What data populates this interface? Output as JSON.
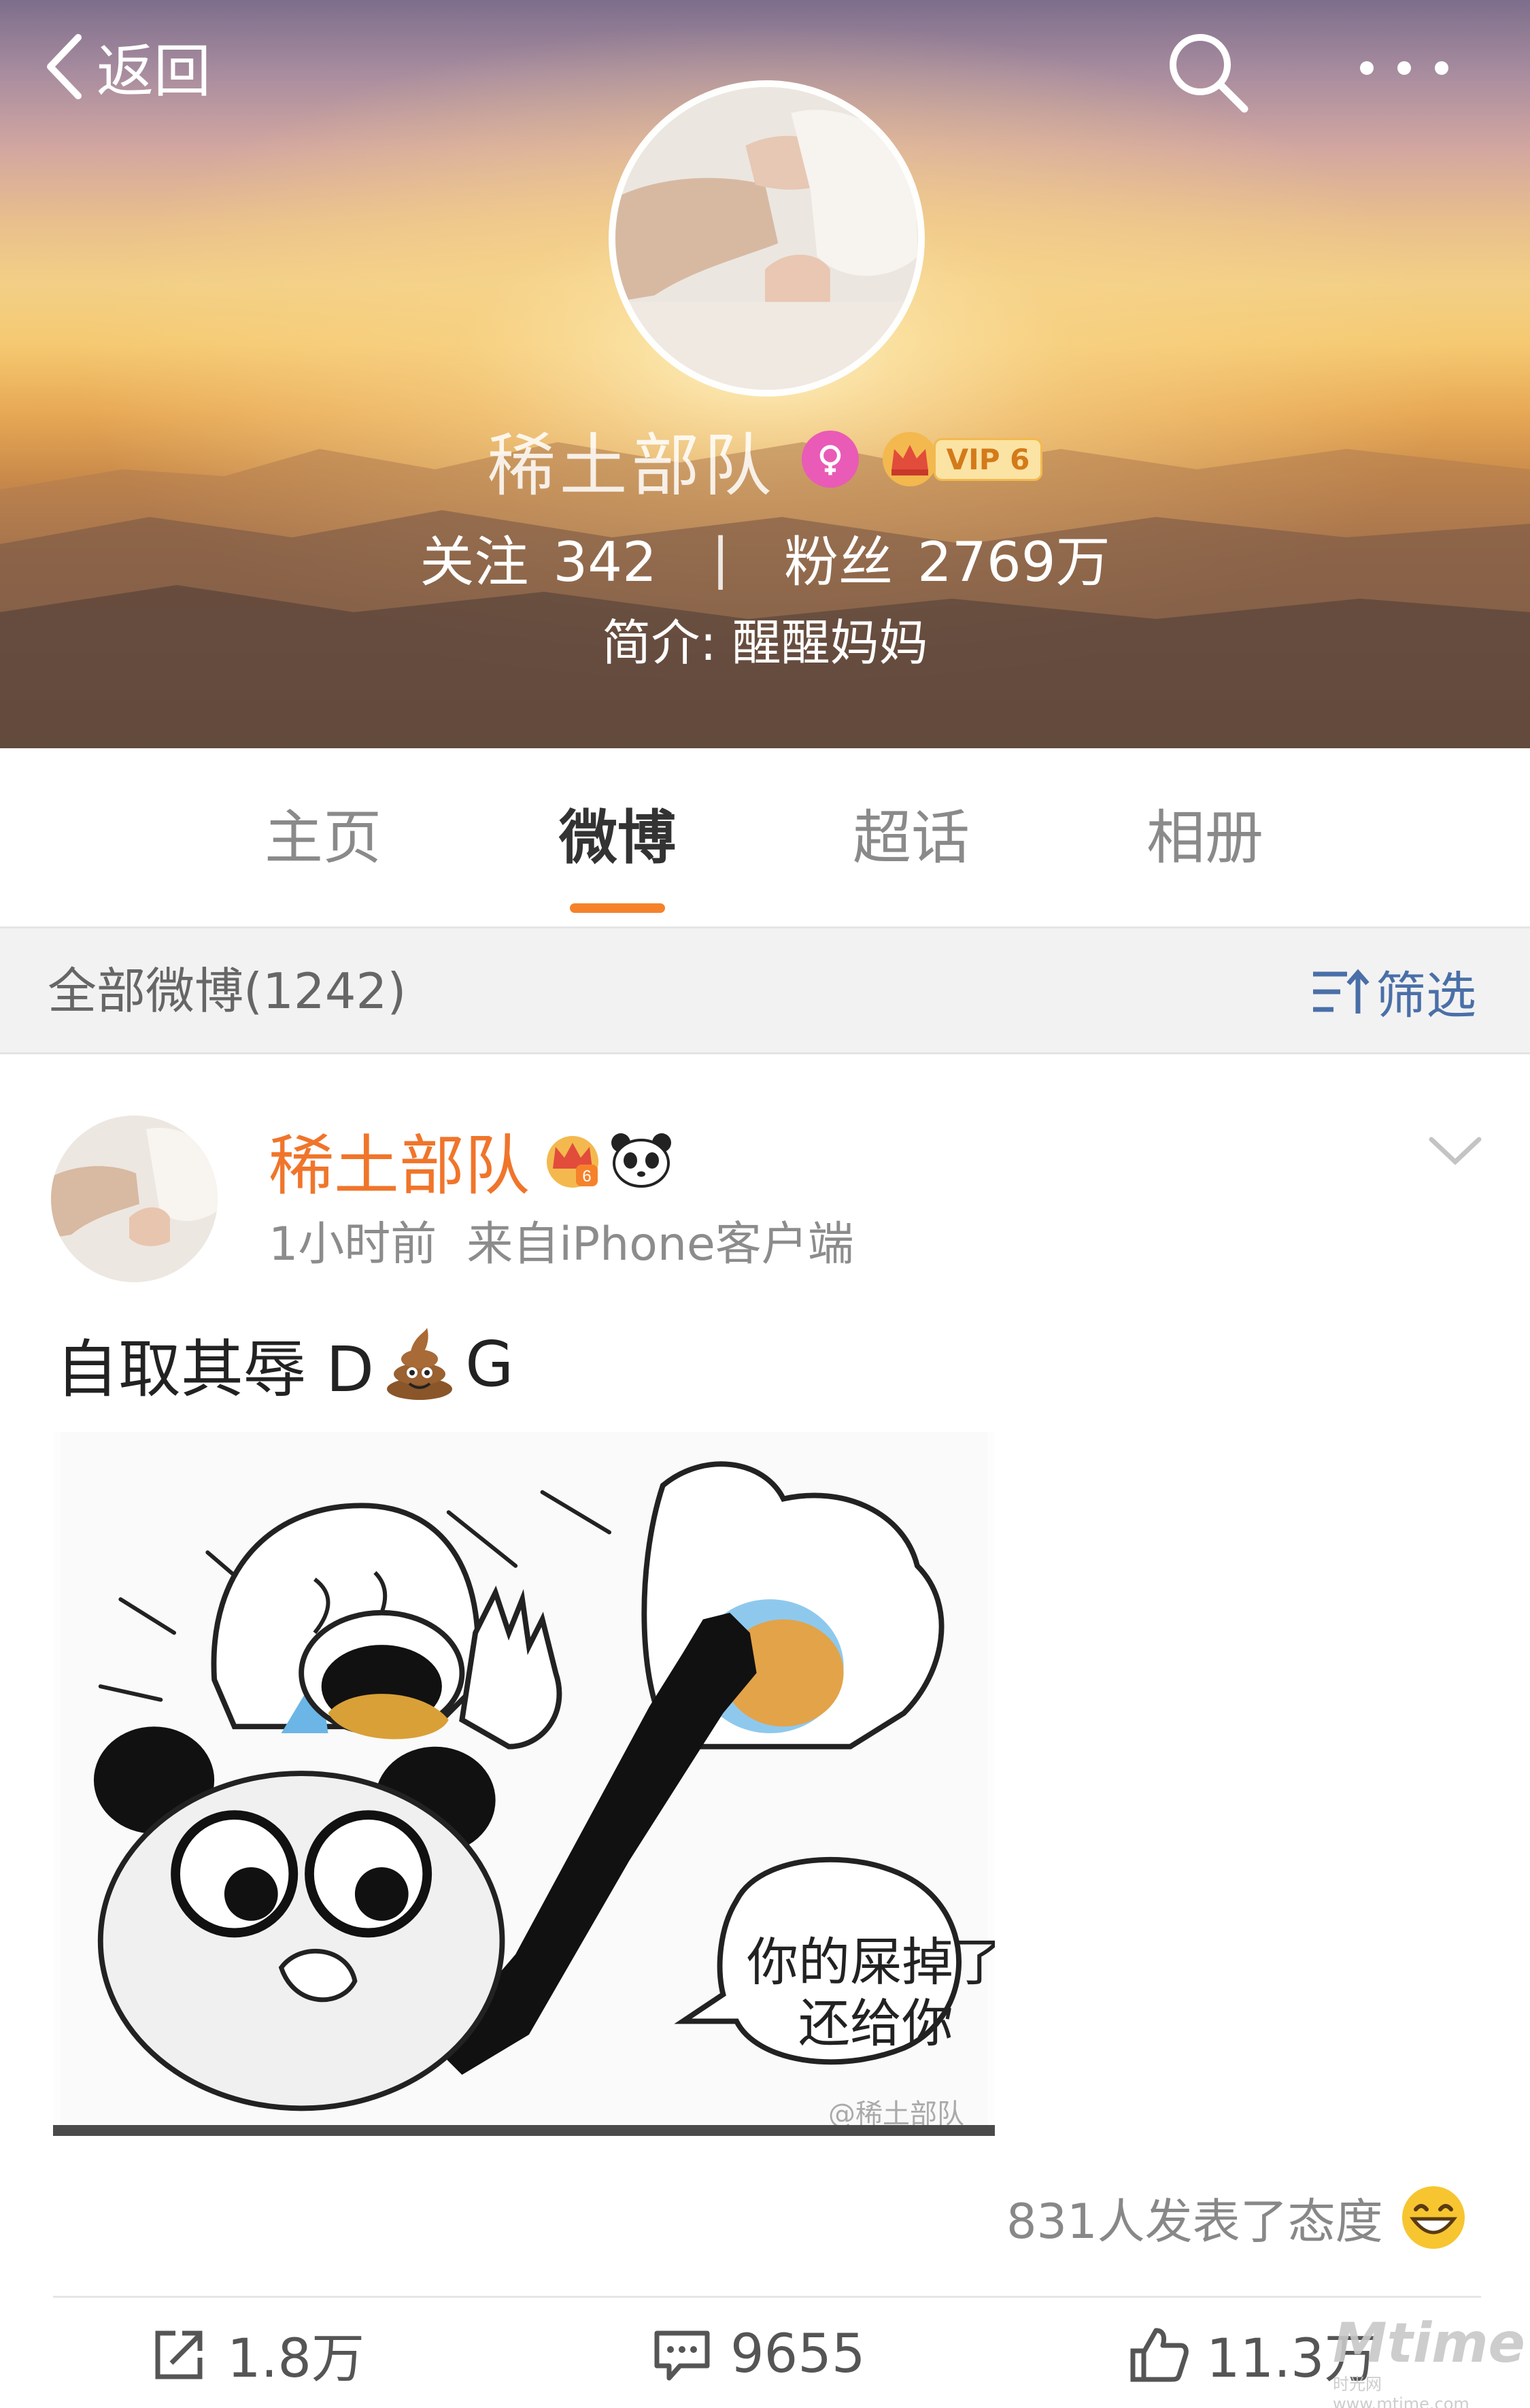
{
  "header": {
    "back_label": "返回",
    "back_icon": "chevron-left-icon",
    "search_icon": "search-icon",
    "more_icon": "more-dots-icon"
  },
  "profile": {
    "name": "稀土部队",
    "vip_label": "VIP 6",
    "following_label": "关注",
    "following_count": "342",
    "separator": "|",
    "followers_label": "粉丝",
    "followers_count": "2769万",
    "intro": "简介: 醒醒妈妈"
  },
  "tabs": [
    {
      "label": "主页",
      "active": false
    },
    {
      "label": "微博",
      "active": true
    },
    {
      "label": "超话",
      "active": false
    },
    {
      "label": "相册",
      "active": false
    }
  ],
  "filter": {
    "summary": "全部微博(1242)",
    "filter_label": "筛选"
  },
  "post": {
    "author": "稀土部队",
    "time": "1小时前",
    "source": "来自iPhone客户端",
    "text_before": "自取其辱 D",
    "text_after": "G",
    "image_caption_line1": "你的屎掉了",
    "image_caption_line2": "还给你",
    "image_watermark": "@稀土部队",
    "reactions_text": "831人发表了态度",
    "repost_count": "1.8万",
    "comment_count": "9655",
    "like_count": "11.3万"
  },
  "watermark": {
    "brand": "Mtime",
    "cn": "时光网",
    "url": "www.mtime.com"
  },
  "colors": {
    "accent_orange": "#f5822a",
    "author_orange": "#f0752b",
    "filter_blue": "#4a6fa8",
    "gender_pink": "#e95bb6"
  }
}
